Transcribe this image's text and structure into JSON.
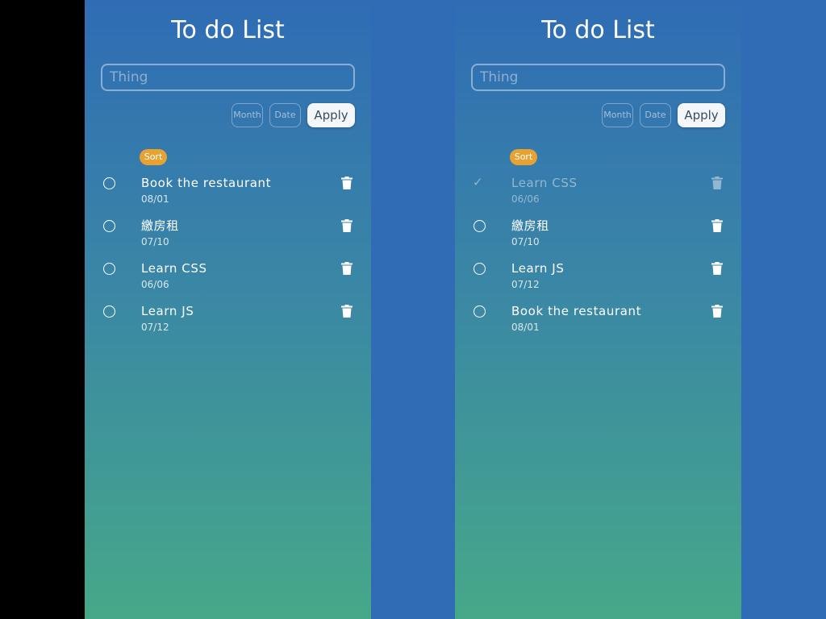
{
  "panels": [
    {
      "title": "To do List",
      "input_placeholder": "Thing",
      "month_label": "Month",
      "date_label": "Date",
      "apply_label": "Apply",
      "sort_label": "Sort",
      "tasks": [
        {
          "text": "Book the restaurant",
          "date": "08/01",
          "done": false
        },
        {
          "text": "繳房租",
          "date": "07/10",
          "done": false
        },
        {
          "text": "Learn CSS",
          "date": "06/06",
          "done": false
        },
        {
          "text": "Learn JS",
          "date": "07/12",
          "done": false
        }
      ]
    },
    {
      "title": "To do List",
      "input_placeholder": "Thing",
      "month_label": "Month",
      "date_label": "Date",
      "apply_label": "Apply",
      "sort_label": "Sort",
      "tasks": [
        {
          "text": "Learn CSS",
          "date": "06/06",
          "done": true
        },
        {
          "text": "繳房租",
          "date": "07/10",
          "done": false
        },
        {
          "text": "Learn JS",
          "date": "07/12",
          "done": false
        },
        {
          "text": "Book the restaurant",
          "date": "08/01",
          "done": false
        }
      ]
    }
  ],
  "icons": {
    "checkbox": "circle-icon",
    "checked": "check-icon",
    "delete": "trash-icon"
  },
  "colors": {
    "background": "#2f6cb5",
    "gradient_top": "#2f6cb5",
    "gradient_bottom": "#46a888",
    "sort_badge": "#e8a231",
    "apply_button": "#f3f6fa"
  }
}
